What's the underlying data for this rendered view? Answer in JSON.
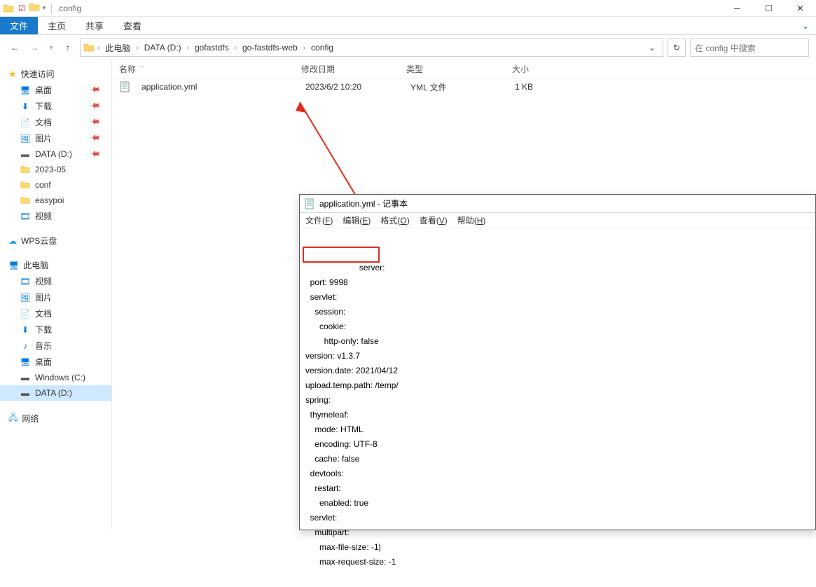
{
  "window": {
    "title": "config"
  },
  "ribbon": {
    "file": "文件",
    "tabs": [
      "主页",
      "共享",
      "查看"
    ]
  },
  "breadcrumb": [
    "此电脑",
    "DATA (D:)",
    "gofastdfs",
    "go-fastdfs-web",
    "config"
  ],
  "search_placeholder": "在 config 中搜索",
  "columns": {
    "name": "名称",
    "date": "修改日期",
    "type": "类型",
    "size": "大小"
  },
  "files": [
    {
      "name": "application.yml",
      "date": "2023/6/2 10:20",
      "type": "YML 文件",
      "size": "1 KB"
    }
  ],
  "sidebar": {
    "quick_access": {
      "label": "快速访问",
      "items": [
        {
          "label": "桌面",
          "icon": "desktop",
          "pinned": true
        },
        {
          "label": "下载",
          "icon": "download",
          "pinned": true
        },
        {
          "label": "文档",
          "icon": "document",
          "pinned": true
        },
        {
          "label": "图片",
          "icon": "picture",
          "pinned": true
        },
        {
          "label": "DATA (D:)",
          "icon": "drive",
          "pinned": true
        },
        {
          "label": "2023-05",
          "icon": "folder",
          "pinned": false
        },
        {
          "label": "conf",
          "icon": "folder",
          "pinned": false
        },
        {
          "label": "easypoi",
          "icon": "folder",
          "pinned": false
        },
        {
          "label": "视频",
          "icon": "video",
          "pinned": false
        }
      ]
    },
    "wps": {
      "label": "WPS云盘"
    },
    "this_pc": {
      "label": "此电脑",
      "items": [
        {
          "label": "视频",
          "icon": "video"
        },
        {
          "label": "图片",
          "icon": "picture"
        },
        {
          "label": "文档",
          "icon": "document"
        },
        {
          "label": "下载",
          "icon": "download"
        },
        {
          "label": "音乐",
          "icon": "music"
        },
        {
          "label": "桌面",
          "icon": "desktop"
        },
        {
          "label": "Windows (C:)",
          "icon": "drive"
        },
        {
          "label": "DATA (D:)",
          "icon": "drive",
          "selected": true
        }
      ]
    },
    "network": {
      "label": "网络"
    }
  },
  "notepad": {
    "title": "application.yml - 记事本",
    "menu": {
      "file": "文件(F)",
      "edit": "编辑(E)",
      "format": "格式(O)",
      "view": "查看(V)",
      "help": "帮助(H)"
    },
    "content": "server:\n  port: 9998\n  servlet:\n    session:\n      cookie:\n        http-only: false\nversion: v1.3.7\nversion.date: 2021/04/12\nupload.temp.path: /temp/\nspring:\n  thymeleaf:\n    mode: HTML\n    encoding: UTF-8\n    cache: false\n  devtools:\n    restart:\n      enabled: true\n  servlet:\n    multipart:\n      max-file-size: -1|\n      max-request-size: -1"
  }
}
